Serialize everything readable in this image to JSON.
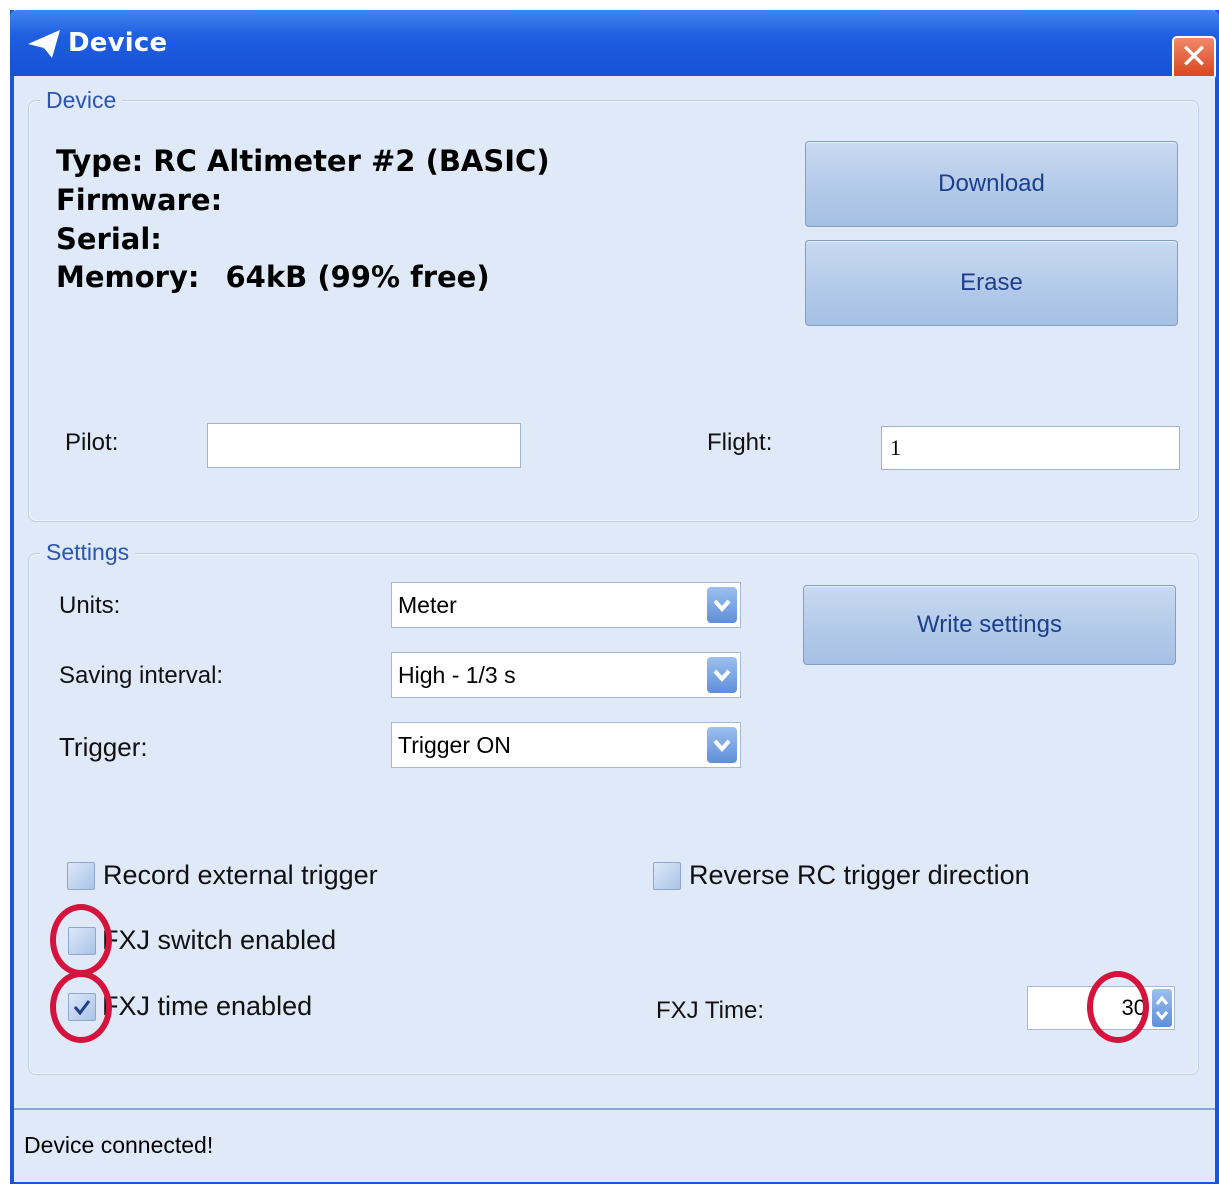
{
  "window": {
    "title": "Device",
    "close_glyph": "✕"
  },
  "device_group": {
    "legend": "Device",
    "type_label": "Type:",
    "type_value": "RC Altimeter #2 (BASIC)",
    "firmware_label": "Firmware:",
    "serial_label": "Serial:",
    "memory_label": "Memory:",
    "memory_value": "64kB (99% free)",
    "download_label": "Download",
    "erase_label": "Erase",
    "pilot_label": "Pilot:",
    "pilot_value": "",
    "flight_label": "Flight:",
    "flight_value": "1"
  },
  "settings_group": {
    "legend": "Settings",
    "units_label": "Units:",
    "units_value": "Meter",
    "saving_interval_label": "Saving interval:",
    "saving_interval_value": "High - 1/3 s",
    "trigger_label": "Trigger:",
    "trigger_value": "Trigger ON",
    "write_settings_label": "Write settings",
    "record_external_trigger_label": "Record external trigger",
    "record_external_trigger_checked": false,
    "reverse_rc_trigger_label": "Reverse RC trigger direction",
    "reverse_rc_trigger_checked": false,
    "fxj_switch_label": "FXJ switch enabled",
    "fxj_switch_checked": false,
    "fxj_time_enabled_label": "FXJ time enabled",
    "fxj_time_enabled_checked": true,
    "fxj_time_label": "FXJ Time:",
    "fxj_time_value": "30"
  },
  "status": {
    "text": "Device connected!"
  },
  "colors": {
    "titlebar": "#1f5ee0",
    "highlight_circle": "#d4143c",
    "button_text": "#1c3f8c"
  }
}
